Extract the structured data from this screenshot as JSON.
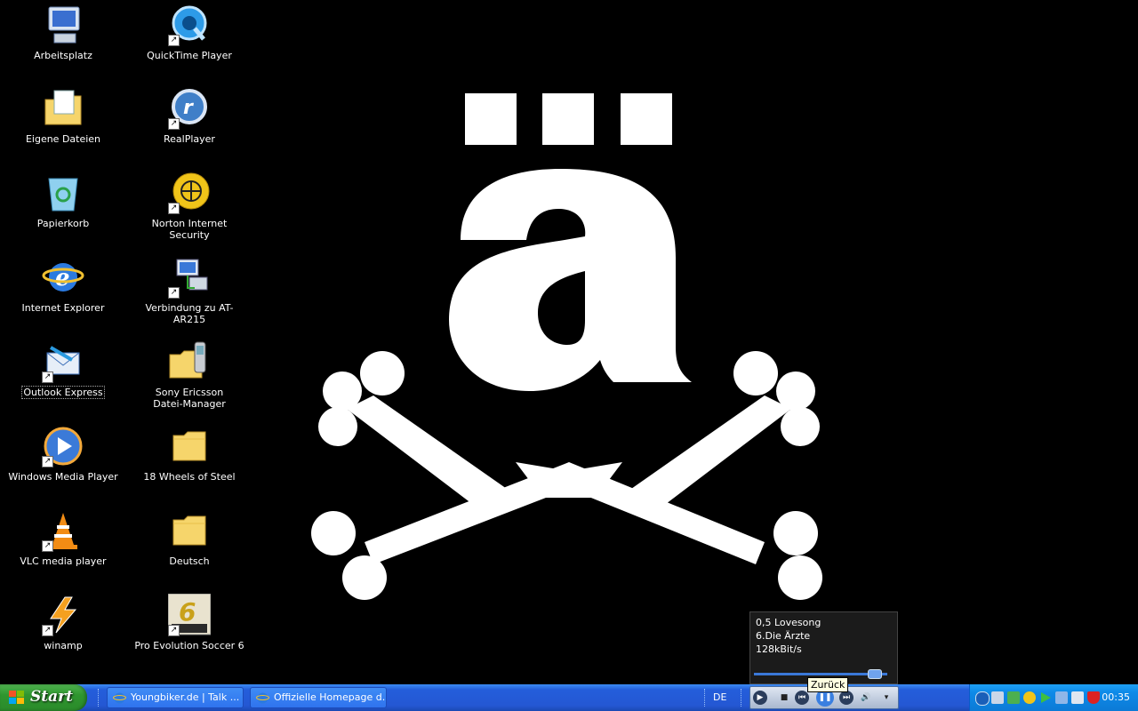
{
  "desktop": {
    "icons": [
      {
        "label": "Arbeitsplatz"
      },
      {
        "label": "Eigene Dateien"
      },
      {
        "label": "Papierkorb"
      },
      {
        "label": "Internet Explorer"
      },
      {
        "label": "Outlook Express"
      },
      {
        "label": "Windows Media Player"
      },
      {
        "label": "VLC media player"
      },
      {
        "label": "winamp"
      },
      {
        "label": "QuickTime Player"
      },
      {
        "label": "RealPlayer"
      },
      {
        "label": "Norton Internet Security"
      },
      {
        "label": "Verbindung zu AT-AR215"
      },
      {
        "label": "Sony Ericsson"
      },
      {
        "label": "Datei-Manager"
      },
      {
        "label": "18 Wheels of Steel"
      },
      {
        "label": "Deutsch"
      },
      {
        "label": "Pro Evolution Soccer 6"
      }
    ]
  },
  "media_popup": {
    "title": "0,5 Lovesong",
    "artist": "6.Die Ärzte",
    "bitrate": "128kBit/s",
    "progress": 0.9
  },
  "taskbar": {
    "start_label": "Start",
    "tasks": [
      {
        "label": "Youngbiker.de | Talk ..."
      },
      {
        "label": "Offizielle Homepage d..."
      }
    ],
    "language": "DE",
    "tooltip": "Zurück",
    "clock": "00:35"
  }
}
